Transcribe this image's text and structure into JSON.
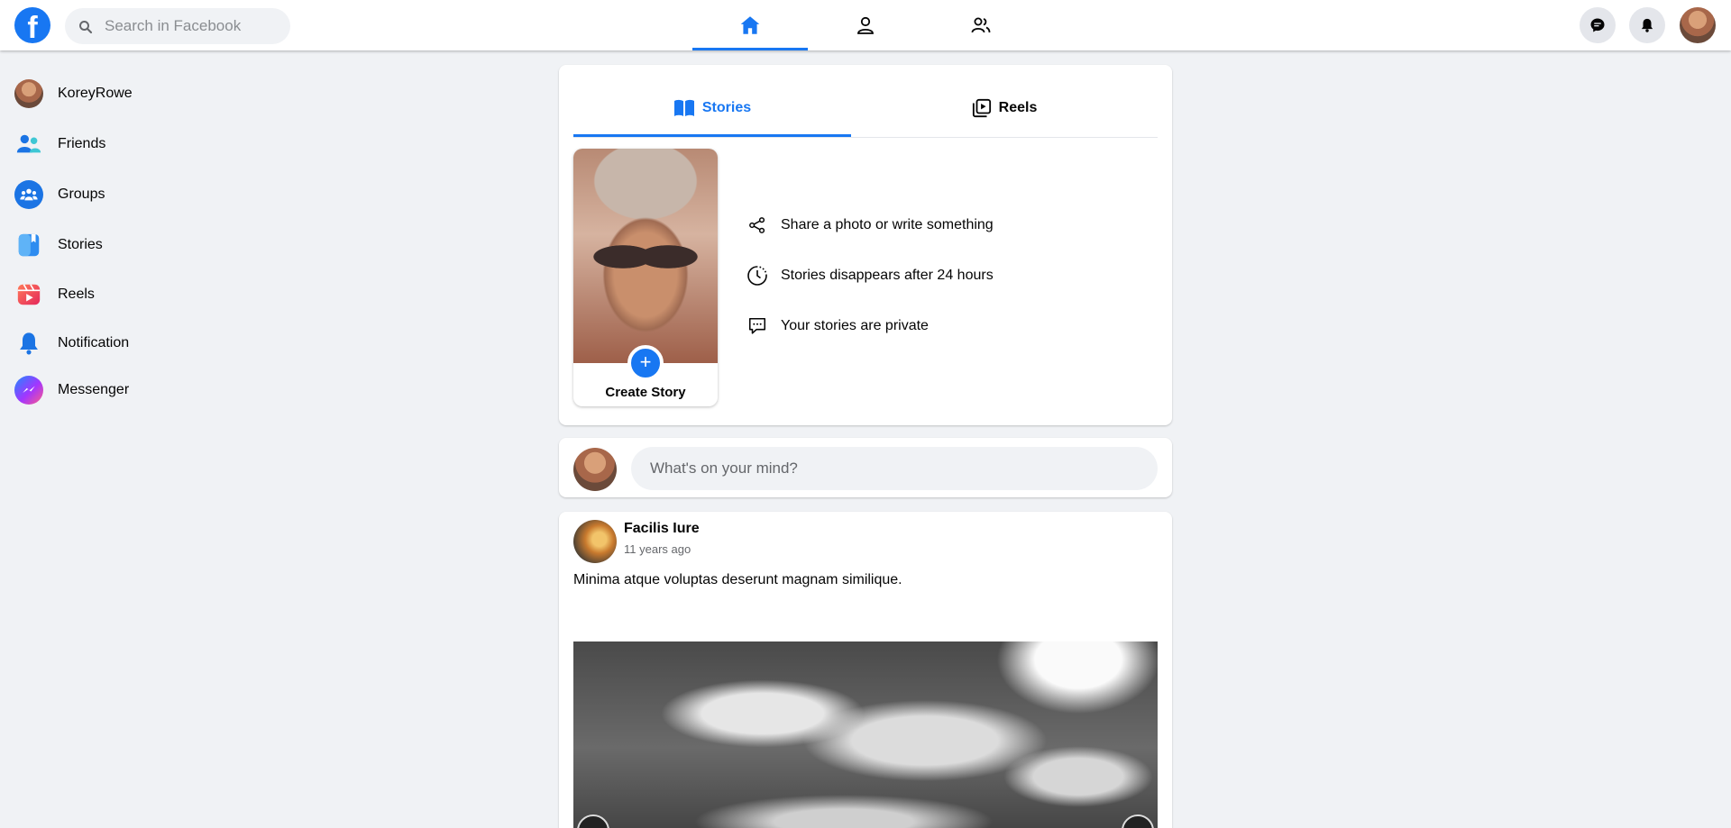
{
  "topbar": {
    "logo": "f",
    "search_placeholder": "Search in Facebook",
    "nav": [
      "home-icon",
      "profile-icon",
      "friends-icon"
    ],
    "right": [
      "messenger-icon",
      "bell-icon",
      "avatar"
    ],
    "accent": "#1877f2"
  },
  "sidebar": {
    "items": [
      {
        "label": "KoreyRowe",
        "icon": "avatar"
      },
      {
        "label": "Friends",
        "icon": "friends-icon"
      },
      {
        "label": "Groups",
        "icon": "groups-icon"
      },
      {
        "label": "Stories",
        "icon": "stories-icon"
      },
      {
        "label": "Reels",
        "icon": "reels-icon"
      },
      {
        "label": "Notification",
        "icon": "bell-icon"
      },
      {
        "label": "Messenger",
        "icon": "messenger-icon"
      }
    ]
  },
  "stories": {
    "tabs": [
      {
        "label": "Stories",
        "icon": "book-icon",
        "active": true
      },
      {
        "label": "Reels",
        "icon": "reels-play-icon",
        "active": false
      }
    ],
    "create_label": "Create Story",
    "create_plus": "+",
    "info": [
      {
        "text": "Share a photo or write something",
        "icon": "share-icon"
      },
      {
        "text": "Stories disappears after 24 hours",
        "icon": "clock-icon"
      },
      {
        "text": "Your stories are private",
        "icon": "chat-icon"
      }
    ]
  },
  "composer": {
    "placeholder": "What's on your mind?"
  },
  "post": {
    "author": "Facilis Iure",
    "time": "11 years ago",
    "text": "Minima atque voluptas deserunt magnam similique.",
    "prev": "‹",
    "next": "›"
  }
}
